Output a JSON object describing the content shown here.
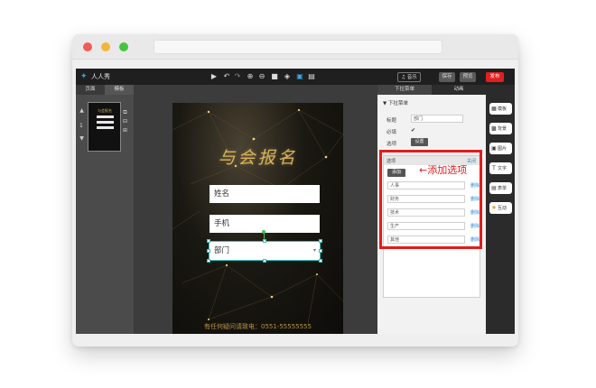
{
  "app": {
    "name": "人人秀"
  },
  "toolbar": {
    "music": "♫ 音乐",
    "save": "保存",
    "preview": "预览",
    "publish": "发布",
    "icons": [
      "play-icon",
      "undo-icon",
      "redo-icon",
      "zoom-in-icon",
      "zoom-out-icon",
      "grid-icon",
      "layers-icon",
      "image-icon",
      "align-icon"
    ]
  },
  "left": {
    "tabs": [
      "页面",
      "模板"
    ],
    "page_number": "1"
  },
  "phone": {
    "title": "与会报名",
    "fields": [
      "姓名",
      "手机"
    ],
    "select_value": "部门",
    "footer": "有任何疑问请致电：0551-55555555"
  },
  "right": {
    "tabs": [
      "下拉菜单",
      "动画"
    ],
    "section": "▼ 下拉菜单",
    "labels": {
      "title": "标题",
      "required": "必填",
      "options": "选项"
    },
    "title_value": "部门",
    "required_mark": "✔",
    "set_button": "设置",
    "options_box": {
      "head_left": "选项",
      "head_right": "关闭",
      "add_button": "添加",
      "items": [
        "人事",
        "财务",
        "技术",
        "生产",
        "其他"
      ],
      "delete_label": "删除"
    }
  },
  "annotation": "←添加选项",
  "side_buttons": [
    "模板",
    "背景",
    "图片",
    "文字",
    "表单",
    "互动"
  ],
  "colors": {
    "accent_red": "#e31b1b",
    "selection": "#31c4c0",
    "gold": "#d9b45a",
    "link_blue": "#2d8ad6"
  }
}
